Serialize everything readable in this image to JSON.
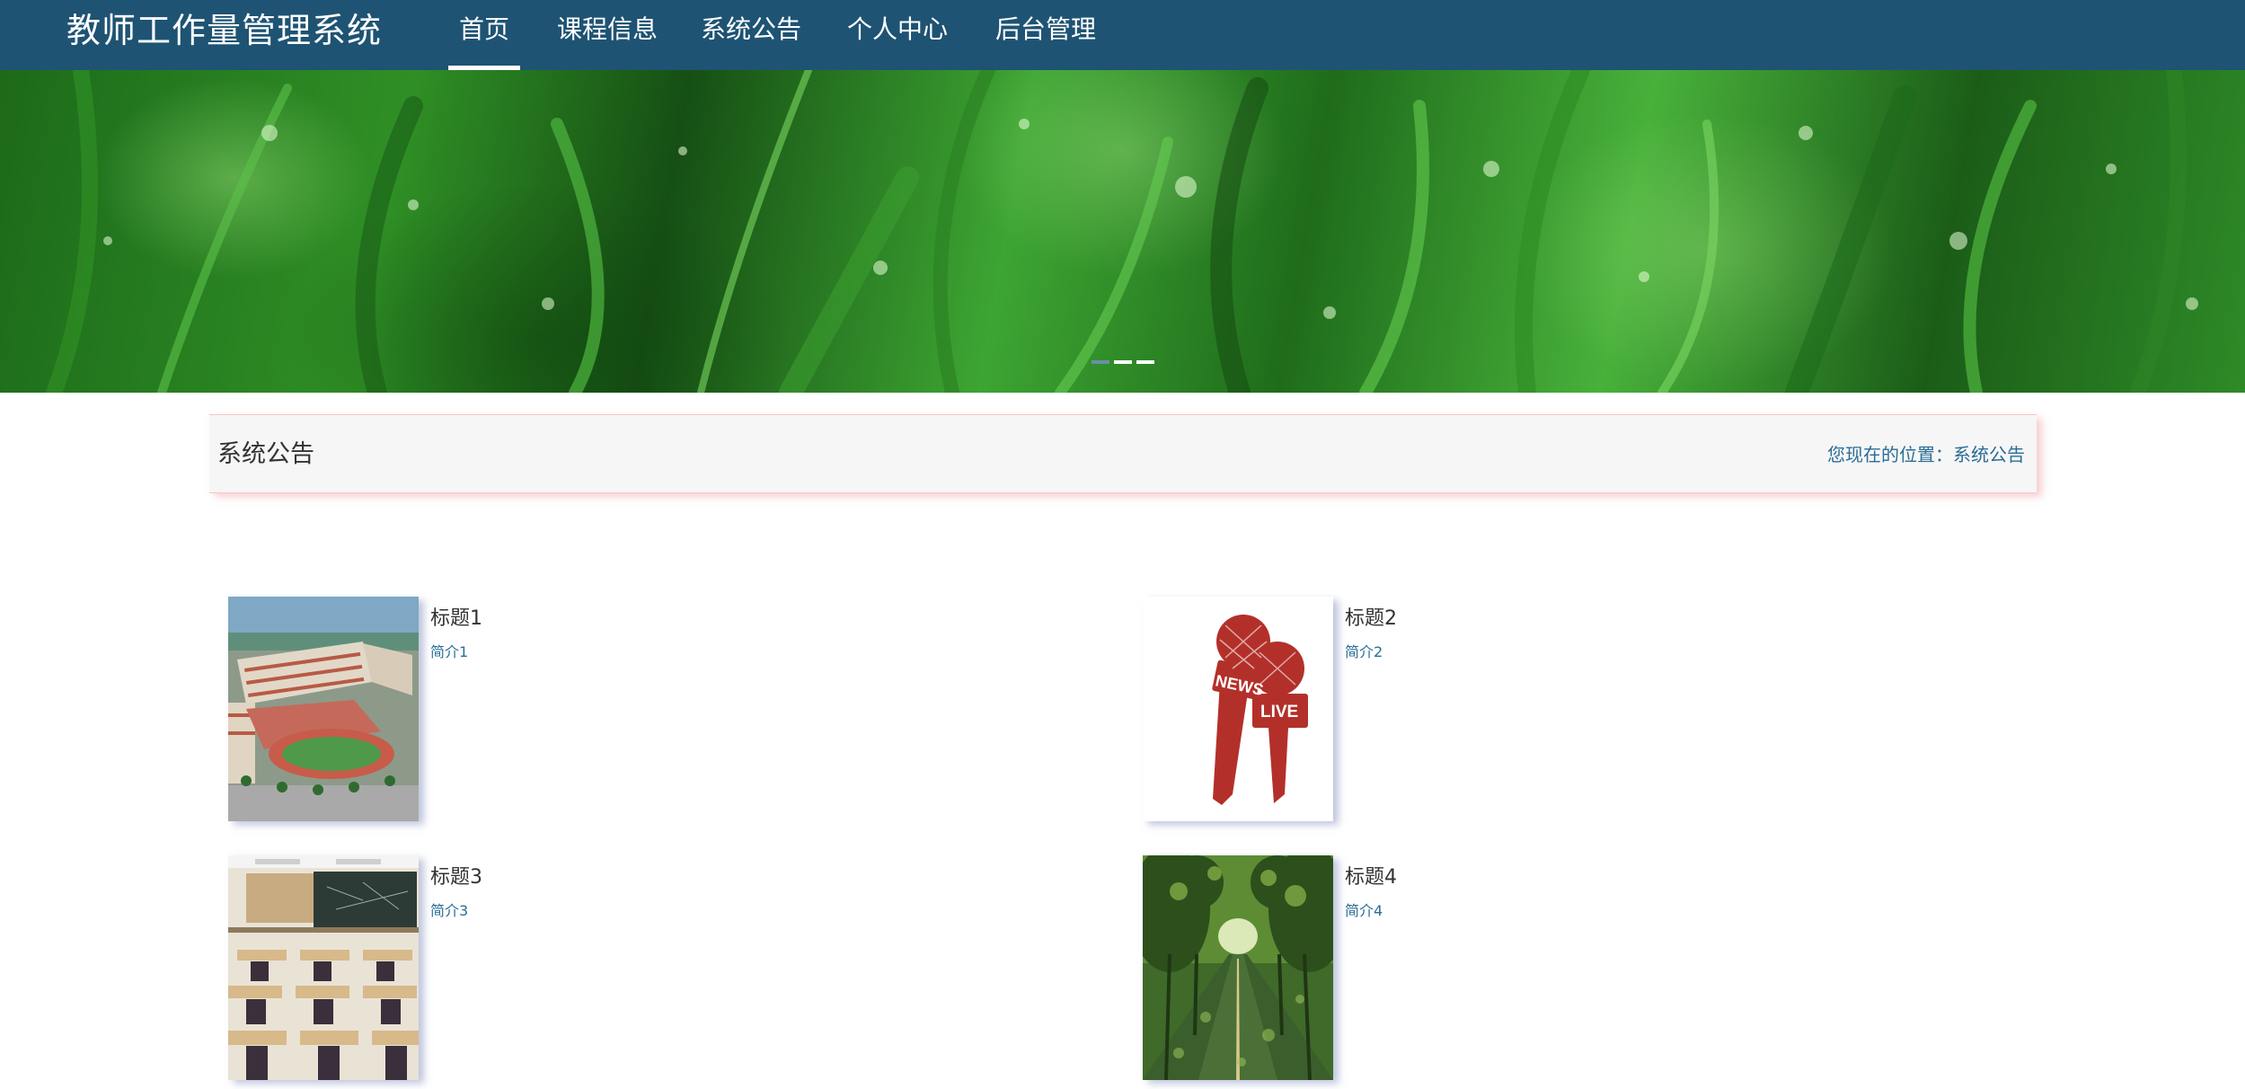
{
  "app": {
    "title": "教师工作量管理系统"
  },
  "nav": {
    "items": [
      {
        "label": "首页",
        "active": true
      },
      {
        "label": "课程信息",
        "active": false
      },
      {
        "label": "系统公告",
        "active": false
      },
      {
        "label": "个人中心",
        "active": false
      },
      {
        "label": "后台管理",
        "active": false
      }
    ]
  },
  "carousel": {
    "slide_count": 3,
    "active_index": 0
  },
  "section": {
    "title": "系统公告",
    "breadcrumb": "您现在的位置：系统公告"
  },
  "announcements": [
    {
      "title": "标题1",
      "summary": "简介1",
      "image": "school-campus-aerial"
    },
    {
      "title": "标题2",
      "summary": "简介2",
      "image": "news-live-microphones"
    },
    {
      "title": "标题3",
      "summary": "简介3",
      "image": "classroom-blackboard"
    },
    {
      "title": "标题4",
      "summary": "简介4",
      "image": "tree-lined-road"
    }
  ],
  "colors": {
    "navbar": "#1e5373",
    "accent_text": "#2a6d96",
    "mic_red": "#b3302a"
  },
  "thumb_text": {
    "news": "NEWS",
    "live": "LIVE"
  }
}
